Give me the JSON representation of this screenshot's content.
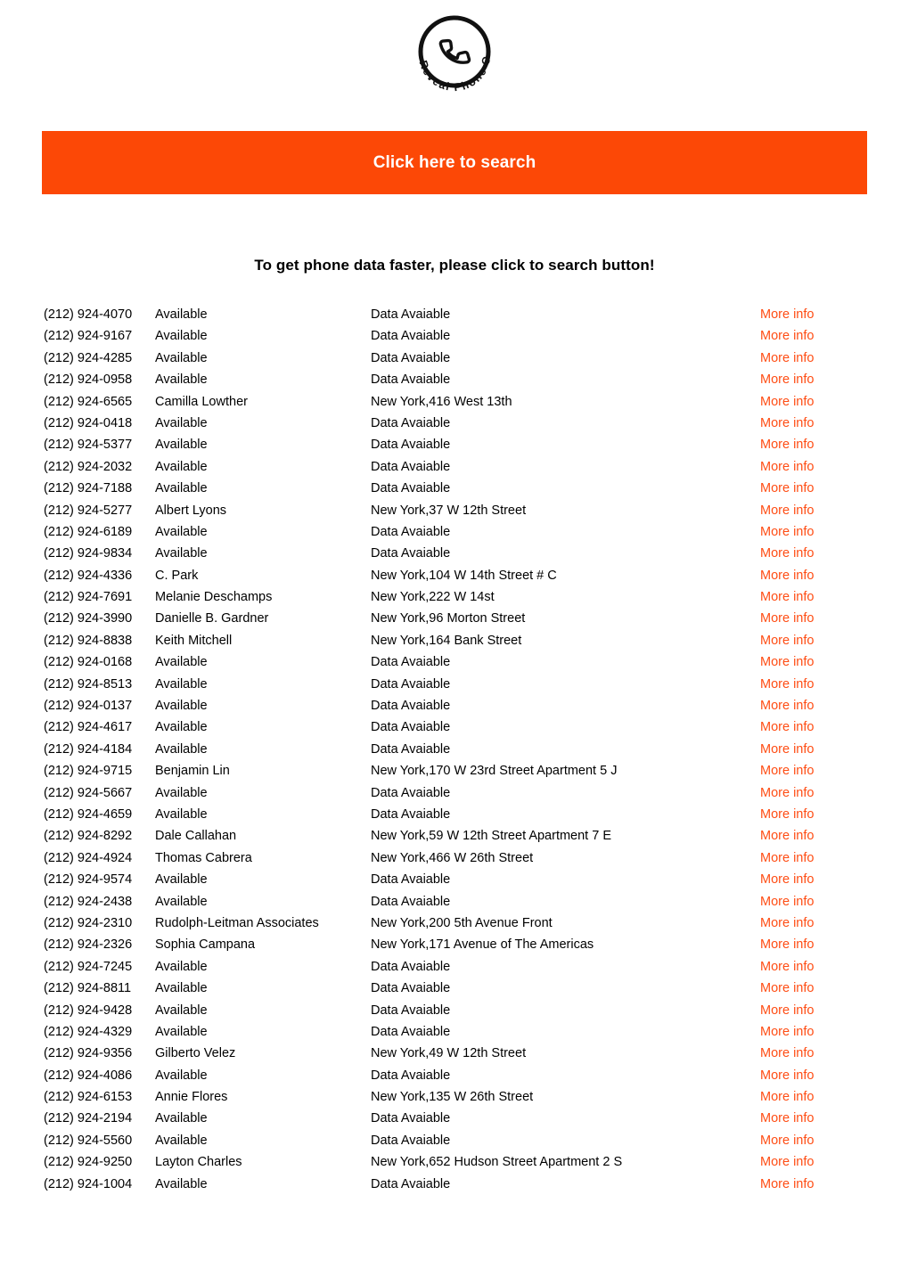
{
  "brand": {
    "logo_icon": "phone-handset-circle-logo",
    "logo_text": "Reveal Phone Owner"
  },
  "search_banner": {
    "label": "Click here to search",
    "background_color": "#fc4806",
    "text_color": "#ffffff"
  },
  "heading": "To get phone data faster, please click to search button!",
  "colors": {
    "accent_orange": "#fc4806",
    "link_orange": "#ff4d14",
    "text": "#000000"
  },
  "results": {
    "more_info_label": "More info",
    "rows": [
      {
        "phone": "(212) 924-4070",
        "name": "Available",
        "address": "Data Avaiable"
      },
      {
        "phone": "(212) 924-9167",
        "name": "Available",
        "address": "Data Avaiable"
      },
      {
        "phone": "(212) 924-4285",
        "name": "Available",
        "address": "Data Avaiable"
      },
      {
        "phone": "(212) 924-0958",
        "name": "Available",
        "address": "Data Avaiable"
      },
      {
        "phone": "(212) 924-6565",
        "name": "Camilla Lowther",
        "address": "New York,416 West 13th"
      },
      {
        "phone": "(212) 924-0418",
        "name": "Available",
        "address": "Data Avaiable"
      },
      {
        "phone": "(212) 924-5377",
        "name": "Available",
        "address": "Data Avaiable"
      },
      {
        "phone": "(212) 924-2032",
        "name": "Available",
        "address": "Data Avaiable"
      },
      {
        "phone": "(212) 924-7188",
        "name": "Available",
        "address": "Data Avaiable"
      },
      {
        "phone": "(212) 924-5277",
        "name": "Albert Lyons",
        "address": "New York,37 W 12th Street"
      },
      {
        "phone": "(212) 924-6189",
        "name": "Available",
        "address": "Data Avaiable"
      },
      {
        "phone": "(212) 924-9834",
        "name": "Available",
        "address": "Data Avaiable"
      },
      {
        "phone": "(212) 924-4336",
        "name": "C. Park",
        "address": "New York,104 W 14th Street # C"
      },
      {
        "phone": "(212) 924-7691",
        "name": "Melanie Deschamps",
        "address": "New York,222 W 14st"
      },
      {
        "phone": "(212) 924-3990",
        "name": "Danielle B. Gardner",
        "address": "New York,96 Morton Street"
      },
      {
        "phone": "(212) 924-8838",
        "name": "Keith Mitchell",
        "address": "New York,164 Bank Street"
      },
      {
        "phone": "(212) 924-0168",
        "name": "Available",
        "address": "Data Avaiable"
      },
      {
        "phone": "(212) 924-8513",
        "name": "Available",
        "address": "Data Avaiable"
      },
      {
        "phone": "(212) 924-0137",
        "name": "Available",
        "address": "Data Avaiable"
      },
      {
        "phone": "(212) 924-4617",
        "name": "Available",
        "address": "Data Avaiable"
      },
      {
        "phone": "(212) 924-4184",
        "name": "Available",
        "address": "Data Avaiable"
      },
      {
        "phone": "(212) 924-9715",
        "name": "Benjamin Lin",
        "address": "New York,170 W 23rd Street Apartment 5 J"
      },
      {
        "phone": "(212) 924-5667",
        "name": "Available",
        "address": "Data Avaiable"
      },
      {
        "phone": "(212) 924-4659",
        "name": "Available",
        "address": "Data Avaiable"
      },
      {
        "phone": "(212) 924-8292",
        "name": "Dale Callahan",
        "address": "New York,59 W 12th Street Apartment 7 E"
      },
      {
        "phone": "(212) 924-4924",
        "name": "Thomas Cabrera",
        "address": "New York,466 W 26th Street"
      },
      {
        "phone": "(212) 924-9574",
        "name": "Available",
        "address": "Data Avaiable"
      },
      {
        "phone": "(212) 924-2438",
        "name": "Available",
        "address": "Data Avaiable"
      },
      {
        "phone": "(212) 924-2310",
        "name": "Rudolph-Leitman Associates",
        "address": "New York,200 5th Avenue Front"
      },
      {
        "phone": "(212) 924-2326",
        "name": "Sophia Campana",
        "address": "New York,171 Avenue of The Americas"
      },
      {
        "phone": "(212) 924-7245",
        "name": "Available",
        "address": "Data Avaiable"
      },
      {
        "phone": "(212) 924-8811",
        "name": "Available",
        "address": "Data Avaiable"
      },
      {
        "phone": "(212) 924-9428",
        "name": "Available",
        "address": "Data Avaiable"
      },
      {
        "phone": "(212) 924-4329",
        "name": "Available",
        "address": "Data Avaiable"
      },
      {
        "phone": "(212) 924-9356",
        "name": "Gilberto Velez",
        "address": "New York,49 W 12th Street"
      },
      {
        "phone": "(212) 924-4086",
        "name": "Available",
        "address": "Data Avaiable"
      },
      {
        "phone": "(212) 924-6153",
        "name": "Annie Flores",
        "address": "New York,135 W 26th Street"
      },
      {
        "phone": "(212) 924-2194",
        "name": "Available",
        "address": "Data Avaiable"
      },
      {
        "phone": "(212) 924-5560",
        "name": "Available",
        "address": "Data Avaiable"
      },
      {
        "phone": "(212) 924-9250",
        "name": "Layton Charles",
        "address": "New York,652 Hudson Street Apartment 2 S"
      },
      {
        "phone": "(212) 924-1004",
        "name": "Available",
        "address": "Data Avaiable"
      }
    ]
  }
}
